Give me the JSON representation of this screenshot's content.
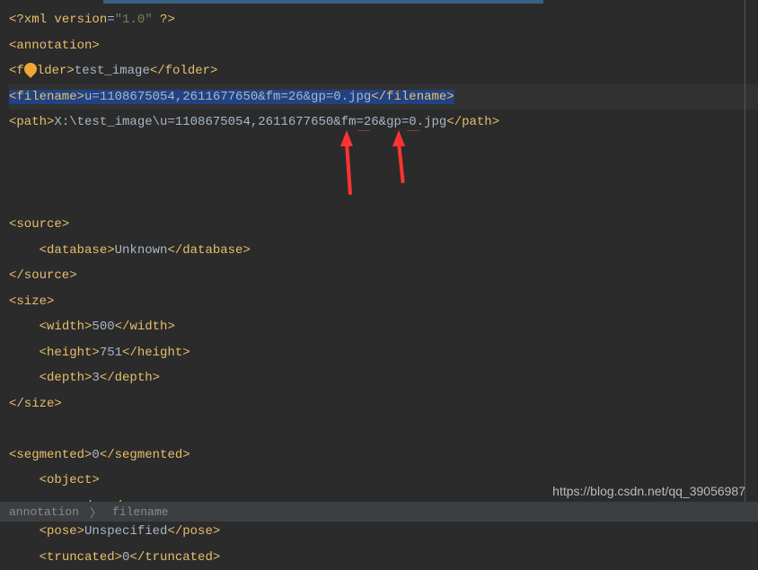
{
  "xml": {
    "decl_open": "<?xml ",
    "decl_attr": "version",
    "decl_eq": "=",
    "decl_val": "\"1.0\"",
    "decl_close": " ?>",
    "annotation_open": "<annotation>",
    "folder_open": "<f",
    "folder_open2": "lder>",
    "folder_text": "test_image",
    "folder_close": "</folder>",
    "filename_open": "<filename>",
    "filename_text": "u=1108675054,2611677650&fm=26&gp=0.jpg",
    "filename_close": "</filename>",
    "path_open": "<path>",
    "path_text": "X:\\test_image\\u=1108675054,2611677650&fm=26&gp=0.jpg",
    "path_close": "</path>",
    "source_open": "<source>",
    "database_open": "<database>",
    "database_text": "Unknown",
    "database_close": "</database>",
    "source_close": "</source>",
    "size_open": "<size>",
    "width_open": "<width>",
    "width_text": "500",
    "width_close": "</width>",
    "height_open": "<height>",
    "height_text": "751",
    "height_close": "</height>",
    "depth_open": "<depth>",
    "depth_text": "3",
    "depth_close": "</depth>",
    "size_close": "</size>",
    "segmented_open": "<segmented>",
    "segmented_text": "0",
    "segmented_close": "</segmented>",
    "object_open": "<object>",
    "name_open": "<name>",
    "name_text": "dog",
    "name_close": "</name>",
    "pose_open": "<pose>",
    "pose_text": "Unspecified",
    "pose_close": "</pose>",
    "truncated_open": "<truncated>",
    "truncated_text": "0",
    "truncated_close": "</truncated>"
  },
  "breadcrumb": {
    "item1": "annotation",
    "sep": "〉",
    "item2": "filename"
  },
  "watermark": "https://blog.csdn.net/qq_39056987"
}
